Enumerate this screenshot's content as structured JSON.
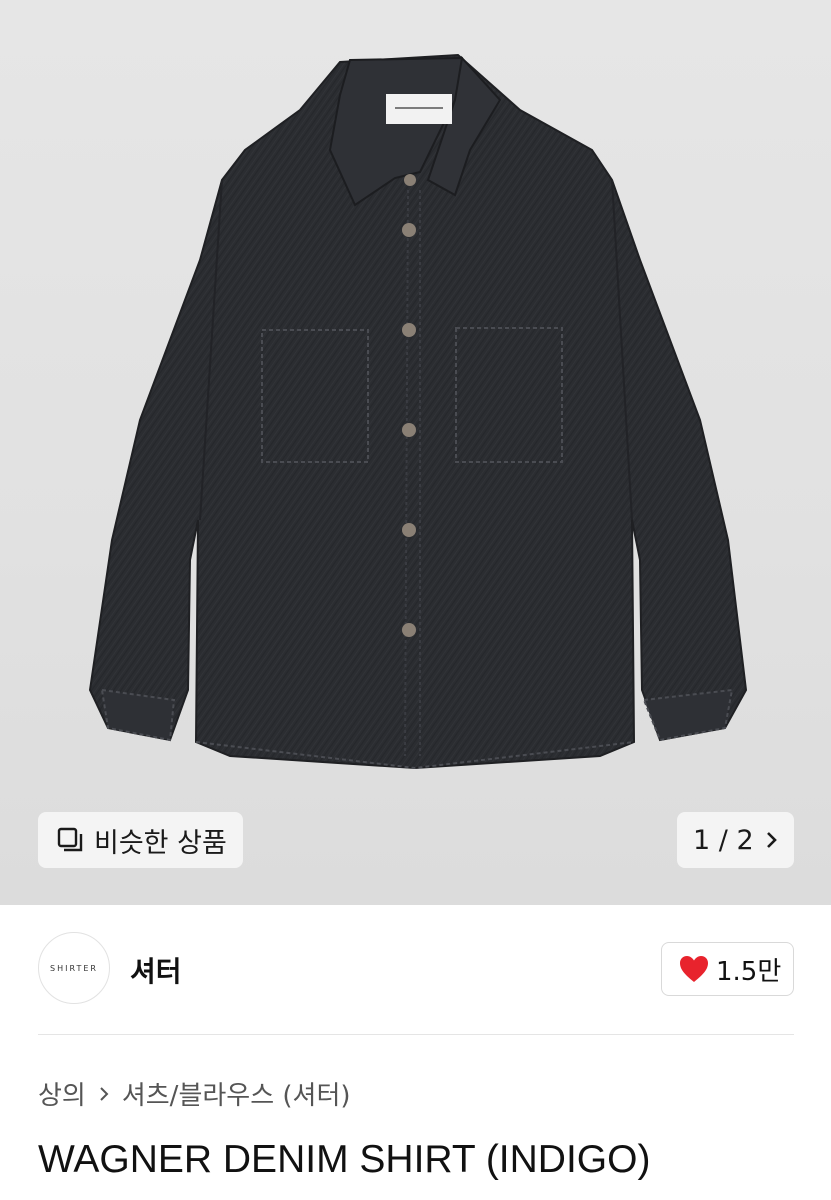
{
  "product_image": {
    "subject": "shirt-image",
    "similar_button_label": "비슷한 상품",
    "pager": "1 / 2"
  },
  "shop": {
    "logo_text": "SHIRTER",
    "name": "셔터",
    "like_count": "1.5만"
  },
  "breadcrumb": {
    "category": "상의",
    "subcategory": "셔츠/블라우스 (셔터)"
  },
  "product": {
    "title": "WAGNER DENIM SHIRT (INDIGO)"
  },
  "colors": {
    "heart": "#e8232d",
    "denim": "#2a2c30"
  }
}
